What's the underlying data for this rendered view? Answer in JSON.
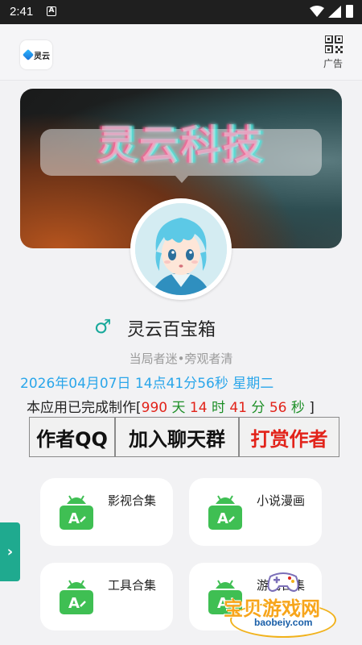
{
  "status_bar": {
    "time": "2:41",
    "notification_letter": "A"
  },
  "header": {
    "logo_text": "灵云",
    "qr_label": "广告"
  },
  "banner": {
    "title": "灵云科技"
  },
  "profile": {
    "gender_symbol": "♂",
    "name": "灵云百宝箱",
    "motto": "当局者迷•旁观者清",
    "datetime": "2026年04月07日 14点41分56秒 星期二",
    "uptime": {
      "prefix": "本应用已完成制作[",
      "days": "990",
      "days_unit": " 天 ",
      "hours": "14",
      "hours_unit": " 时 ",
      "minutes": "41",
      "minutes_unit": " 分 ",
      "seconds": "56",
      "seconds_unit": " 秒 ",
      "suffix": "]"
    }
  },
  "actions": [
    {
      "label": "作者QQ"
    },
    {
      "label": "加入聊天群"
    },
    {
      "label": "打赏作者"
    }
  ],
  "cards": [
    {
      "label": "影视合集"
    },
    {
      "label": "小说漫画"
    },
    {
      "label": "工具合集"
    },
    {
      "label": "游戏合集"
    }
  ],
  "side_tab": {
    "symbol": "›"
  },
  "watermark": {
    "title": "宝贝游戏网",
    "url": "baobeiy.com"
  },
  "colors": {
    "accent_teal": "#1faa8f",
    "date_blue": "#2aa6ea",
    "number_red": "#e2231a",
    "unit_green": "#1d8f27",
    "icon_green": "#3fbf53"
  }
}
